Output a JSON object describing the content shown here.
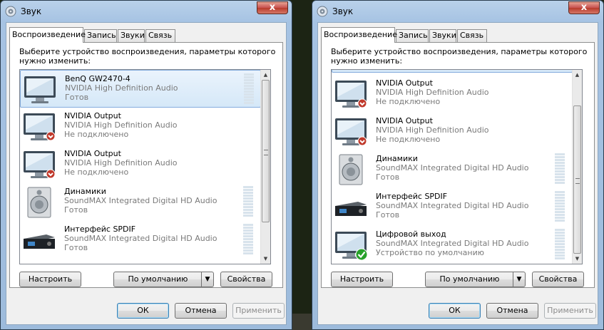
{
  "windows": [
    {
      "title": "Звук",
      "close_label": "x",
      "tabs": [
        {
          "label": "Воспроизведение",
          "active": true
        },
        {
          "label": "Запись",
          "active": false
        },
        {
          "label": "Звуки",
          "active": false
        },
        {
          "label": "Связь",
          "active": false
        }
      ],
      "instruction": "Выберите устройство воспроизведения, параметры которого нужно изменить:",
      "devices": [
        {
          "name": "BenQ GW2470-4",
          "driver": "NVIDIA High Definition Audio",
          "status": "Готов",
          "icon": "monitor-icon",
          "selected": true,
          "meter": true,
          "badge": ""
        },
        {
          "name": "NVIDIA Output",
          "driver": "NVIDIA High Definition Audio",
          "status": "Не подключено",
          "icon": "monitor-icon",
          "selected": false,
          "meter": false,
          "badge": "disconnected"
        },
        {
          "name": "NVIDIA Output",
          "driver": "NVIDIA High Definition Audio",
          "status": "Не подключено",
          "icon": "monitor-icon",
          "selected": false,
          "meter": false,
          "badge": "disconnected"
        },
        {
          "name": "Динамики",
          "driver": "SoundMAX Integrated Digital HD Audio",
          "status": "Готов",
          "icon": "speaker-icon",
          "selected": false,
          "meter": true,
          "badge": ""
        },
        {
          "name": "Интерфейс SPDIF",
          "driver": "SoundMAX Integrated Digital HD Audio",
          "status": "Готов",
          "icon": "spdif-icon",
          "selected": false,
          "meter": true,
          "badge": ""
        }
      ],
      "buttons": {
        "configure": "Настроить",
        "default": "По умолчанию",
        "properties": "Свойства",
        "ok": "ОК",
        "cancel": "Отмена",
        "apply": "Применить"
      }
    },
    {
      "title": "Звук",
      "close_label": "x",
      "tabs": [
        {
          "label": "Воспроизведение",
          "active": true
        },
        {
          "label": "Запись",
          "active": false
        },
        {
          "label": "Звуки",
          "active": false
        },
        {
          "label": "Связь",
          "active": false
        }
      ],
      "instruction": "Выберите устройство воспроизведения, параметры которого нужно изменить:",
      "devices": [
        {
          "name": "NVIDIA Output",
          "driver": "NVIDIA High Definition Audio",
          "status": "Не подключено",
          "icon": "monitor-icon",
          "selected": false,
          "meter": false,
          "badge": "disconnected"
        },
        {
          "name": "NVIDIA Output",
          "driver": "NVIDIA High Definition Audio",
          "status": "Не подключено",
          "icon": "monitor-icon",
          "selected": false,
          "meter": false,
          "badge": "disconnected"
        },
        {
          "name": "Динамики",
          "driver": "SoundMAX Integrated Digital HD Audio",
          "status": "Готов",
          "icon": "speaker-icon",
          "selected": false,
          "meter": true,
          "badge": ""
        },
        {
          "name": "Интерфейс SPDIF",
          "driver": "SoundMAX Integrated Digital HD Audio",
          "status": "Готов",
          "icon": "spdif-icon",
          "selected": false,
          "meter": true,
          "badge": ""
        },
        {
          "name": "Цифровой выход",
          "driver": "SoundMAX Integrated Digital HD Audio",
          "status": "Устройство по умолчанию",
          "icon": "monitor-icon",
          "selected": false,
          "meter": true,
          "badge": "default"
        }
      ],
      "buttons": {
        "configure": "Настроить",
        "default": "По умолчанию",
        "properties": "Свойства",
        "ok": "ОК",
        "cancel": "Отмена",
        "apply": "Применить"
      }
    }
  ],
  "colors": {
    "selection": "#d5e8f8",
    "disconnected_badge": "#c0392b",
    "default_badge": "#27a12a",
    "window_frame": "#a6c3e3"
  }
}
